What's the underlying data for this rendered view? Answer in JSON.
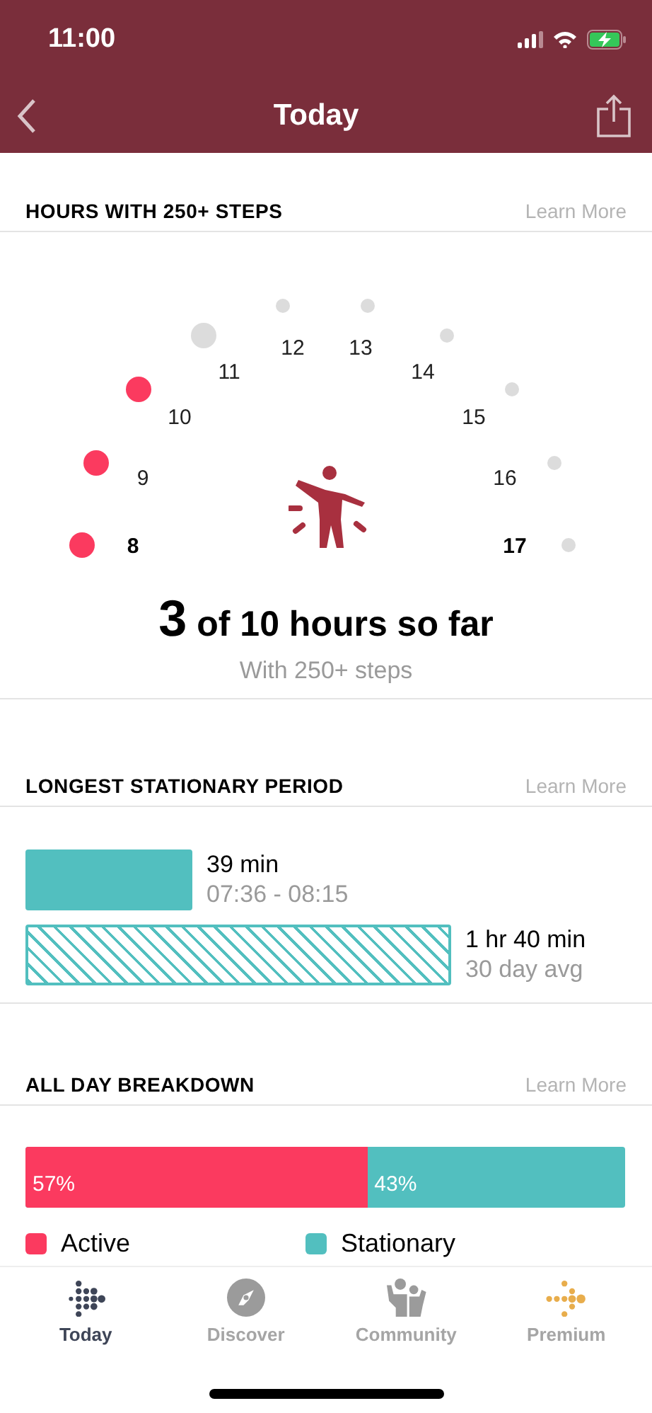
{
  "status_bar": {
    "time": "11:00"
  },
  "nav": {
    "title": "Today"
  },
  "hours_section": {
    "heading": "HOURS WITH 250+ STEPS",
    "link": "Learn More",
    "hours": [
      {
        "label": "8",
        "active": true,
        "current": false
      },
      {
        "label": "9",
        "active": true,
        "current": false
      },
      {
        "label": "10",
        "active": true,
        "current": false
      },
      {
        "label": "11",
        "active": false,
        "current": true
      },
      {
        "label": "12",
        "active": false,
        "current": false
      },
      {
        "label": "13",
        "active": false,
        "current": false
      },
      {
        "label": "14",
        "active": false,
        "current": false
      },
      {
        "label": "15",
        "active": false,
        "current": false
      },
      {
        "label": "16",
        "active": false,
        "current": false
      },
      {
        "label": "17",
        "active": false,
        "current": false
      }
    ],
    "count": "3",
    "summary": "of 10 hours so far",
    "subtitle": "With 250+ steps"
  },
  "stationary_section": {
    "heading": "LONGEST STATIONARY PERIOD",
    "link": "Learn More",
    "bars": [
      {
        "kind": "solid",
        "value": "39 min",
        "detail": "07:36 - 08:15"
      },
      {
        "kind": "hatched",
        "value": "1 hr 40 min",
        "detail": "30 day avg"
      }
    ]
  },
  "breakdown_section": {
    "heading": "ALL DAY BREAKDOWN",
    "link": "Learn More",
    "segments": [
      {
        "percent": "57%",
        "name": "Active",
        "level": 0.57,
        "color": "#fb3a5f"
      },
      {
        "percent": "43%",
        "name": "Stationary",
        "color": "#52bfbf"
      }
    ]
  },
  "tabs": [
    {
      "kind": "today",
      "label": "Today",
      "selected": true
    },
    {
      "kind": "discover",
      "label": "Discover",
      "selected": false
    },
    {
      "kind": "community",
      "label": "Community",
      "selected": false
    },
    {
      "kind": "premium",
      "label": "Premium",
      "selected": false
    }
  ]
}
